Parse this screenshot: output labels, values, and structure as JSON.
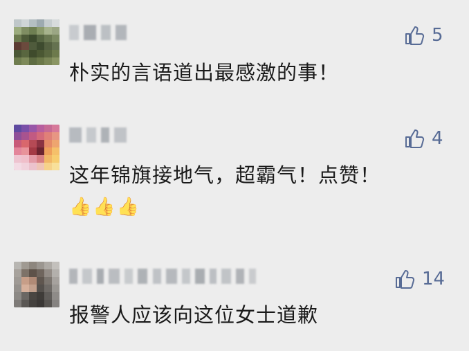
{
  "comments": [
    {
      "likes": "5",
      "text": "朴实的言语道出最感激的事！",
      "emojis": []
    },
    {
      "likes": "4",
      "text": "这年锦旗接地气，超霸气！点赞！",
      "emojis": [
        "👍",
        "👍",
        "👍"
      ]
    },
    {
      "likes": "14",
      "text": "报警人应该向这位女士道歉",
      "emojis": []
    }
  ],
  "colors": {
    "background": "#ededed",
    "text": "#1a1a1a",
    "like": "#576b95"
  },
  "icons": {
    "like": "thumbs-up-icon",
    "emoji": "thumbs-up-emoji"
  }
}
